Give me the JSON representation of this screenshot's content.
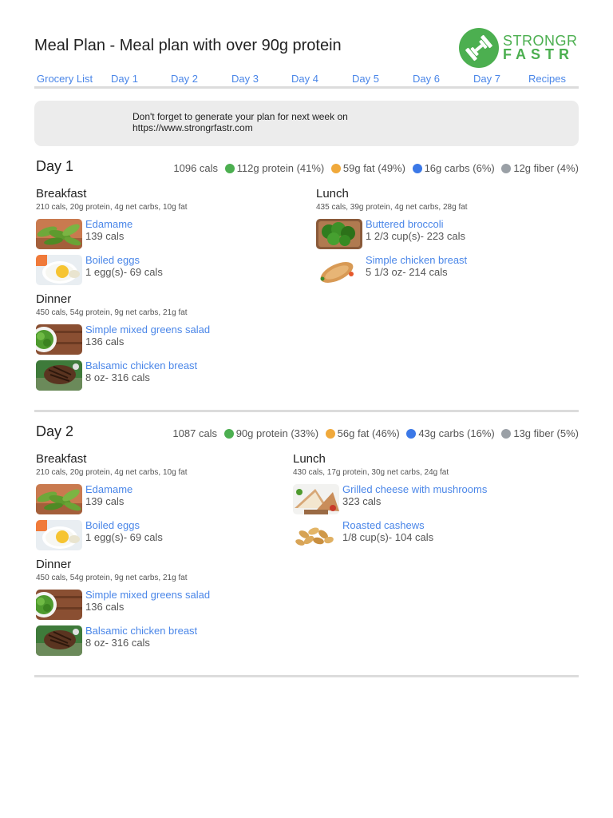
{
  "header": {
    "title": "Meal Plan - Meal plan with over 90g protein",
    "logo_line1": "STRONGR",
    "logo_line2": "FASTR"
  },
  "nav": [
    "Grocery List",
    "Day 1",
    "Day 2",
    "Day 3",
    "Day 4",
    "Day 5",
    "Day 6",
    "Day 7",
    "Recipes"
  ],
  "notice": {
    "line1": "Don't forget to generate your plan for next week on",
    "line2": "https://www.strongrfastr.com"
  },
  "colors": {
    "protein": "#4caf50",
    "fat": "#f0a93b",
    "carbs": "#3b78e7",
    "fiber": "#9aa0a6",
    "link": "#4a86e8"
  },
  "days": [
    {
      "title": "Day 1",
      "summary": {
        "cals": "1096 cals",
        "protein": "112g protein (41%)",
        "fat": "59g fat (49%)",
        "carbs": "16g carbs (6%)",
        "fiber": "12g fiber (4%)"
      },
      "breakfast": {
        "title": "Breakfast",
        "macros": "210 cals, 20g protein, 4g net carbs, 10g fat",
        "foods": [
          {
            "name": "Edamame",
            "amount": "139 cals",
            "icon": "edamame-photo"
          },
          {
            "name": "Boiled eggs",
            "amount": "1 egg(s)- 69 cals",
            "icon": "boiled-eggs-photo"
          }
        ]
      },
      "lunch": {
        "title": "Lunch",
        "macros": "435 cals, 39g protein, 4g net carbs, 28g fat",
        "foods": [
          {
            "name": "Buttered broccoli",
            "amount": "1 2/3 cup(s)- 223 cals",
            "icon": "broccoli-photo"
          },
          {
            "name": "Simple chicken breast",
            "amount": "5 1/3 oz- 214 cals",
            "icon": "chicken-breast-photo"
          }
        ]
      },
      "dinner": {
        "title": "Dinner",
        "macros": "450 cals, 54g protein, 9g net carbs, 21g fat",
        "foods": [
          {
            "name": "Simple mixed greens salad",
            "amount": "136 cals",
            "icon": "greens-salad-photo"
          },
          {
            "name": "Balsamic chicken breast",
            "amount": "8 oz- 316 cals",
            "icon": "balsamic-chicken-photo"
          }
        ]
      }
    },
    {
      "title": "Day 2",
      "summary": {
        "cals": "1087 cals",
        "protein": "90g protein (33%)",
        "fat": "56g fat (46%)",
        "carbs": "43g carbs (16%)",
        "fiber": "13g fiber (5%)"
      },
      "breakfast": {
        "title": "Breakfast",
        "macros": "210 cals, 20g protein, 4g net carbs, 10g fat",
        "foods": [
          {
            "name": "Edamame",
            "amount": "139 cals",
            "icon": "edamame-photo"
          },
          {
            "name": "Boiled eggs",
            "amount": "1 egg(s)- 69 cals",
            "icon": "boiled-eggs-photo"
          }
        ]
      },
      "lunch": {
        "title": "Lunch",
        "macros": "430 cals, 17g protein, 30g net carbs, 24g fat",
        "foods": [
          {
            "name": "Grilled cheese with mushrooms",
            "amount": "323 cals",
            "icon": "grilled-cheese-photo"
          },
          {
            "name": "Roasted cashews",
            "amount": "1/8 cup(s)- 104 cals",
            "icon": "cashews-photo"
          }
        ]
      },
      "dinner": {
        "title": "Dinner",
        "macros": "450 cals, 54g protein, 9g net carbs, 21g fat",
        "foods": [
          {
            "name": "Simple mixed greens salad",
            "amount": "136 cals",
            "icon": "greens-salad-photo"
          },
          {
            "name": "Balsamic chicken breast",
            "amount": "8 oz- 316 cals",
            "icon": "balsamic-chicken-photo"
          }
        ]
      }
    }
  ]
}
